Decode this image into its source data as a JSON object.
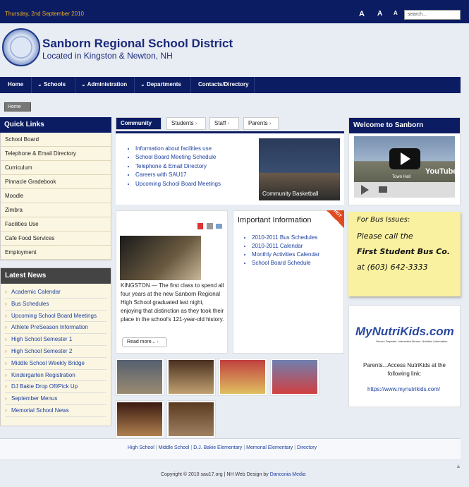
{
  "header": {
    "date": "Thursday, 2nd September 2010",
    "font_controls": [
      "A",
      "A",
      "A"
    ],
    "search_placeholder": "search...",
    "title": "Sanborn Regional School District",
    "subtitle": "Located in Kingston & Newton, NH"
  },
  "nav": {
    "items": [
      "Home",
      "Schools",
      "Administration",
      "Departments",
      "Contacts/Directory"
    ]
  },
  "breadcrumb": {
    "home": "Home"
  },
  "quick_links": {
    "title": "Quick Links",
    "items": [
      "School Board",
      "Telephone & Email Directory",
      "Curriculum",
      "Pinnacle Gradebook",
      "Moodle",
      "Zimbra",
      "Facilities Use",
      "Cafe Food Services",
      "Employment"
    ]
  },
  "latest_news": {
    "title": "Latest News",
    "items": [
      "Academic Calendar",
      "Bus Schedules",
      "Upcoming School Board Meetings",
      "Athlete PreSeason Information",
      "High School Semester 1",
      "High School Semester 2",
      "Middle School Weekly Bridge",
      "Kindergarten Registration",
      "DJ Bakie Drop Off/Pick Up",
      "September Menus",
      "Memorial School News"
    ]
  },
  "tabs": [
    "Community",
    "Students",
    "Staff",
    "Parents"
  ],
  "community": {
    "links": [
      "Information about facilities use",
      "School Board Meeting Schedule",
      "Telephone & Email Directory",
      "Careers with SAU17",
      "Upcoming School Board Meetings"
    ],
    "photo_caption": "Community Basketball"
  },
  "article": {
    "text": "KINGSTON — The first class to spend all four years at the new Sanborn Regional High School graduated last night, enjoying that distinction as they took their place in the school's 121-year-old history.",
    "read_more": "Read more..."
  },
  "important": {
    "title": "Important Information",
    "badge": "HOT",
    "links": [
      "2010-2011 Bus Schedules",
      "2010-2011 Calendar",
      "Monthly Activities Calendar",
      "School Board Schedule"
    ]
  },
  "welcome": {
    "title": "Welcome to Sanborn",
    "video_caption": "Town Hall",
    "video_brand": "YouTube"
  },
  "bus": {
    "heading": "For Bus Issues:",
    "line1": "Please call the",
    "line2": "First Student Bus Co.",
    "line3": "at (603) 642-3333"
  },
  "nutrikids": {
    "logo": "MyNutriKids.com",
    "tagline": "Secure Deposits. Interactive Menus. Nutrition Information.",
    "text": "Parents...Access NutriKids at the following link:",
    "url": "https://www.mynutrikids.com/"
  },
  "footer": {
    "links": [
      "High School",
      "Middle School",
      "D.J. Bakie Elementary",
      "Memorial Elementary",
      "Directory"
    ],
    "copyright": "Copyright © 2010 sau17.org | NH Web Design by ",
    "designer": "Danconia Media"
  },
  "colors": {
    "nav": "#0b1c63",
    "date": "#f0b020",
    "note": "#f9f1a0"
  }
}
